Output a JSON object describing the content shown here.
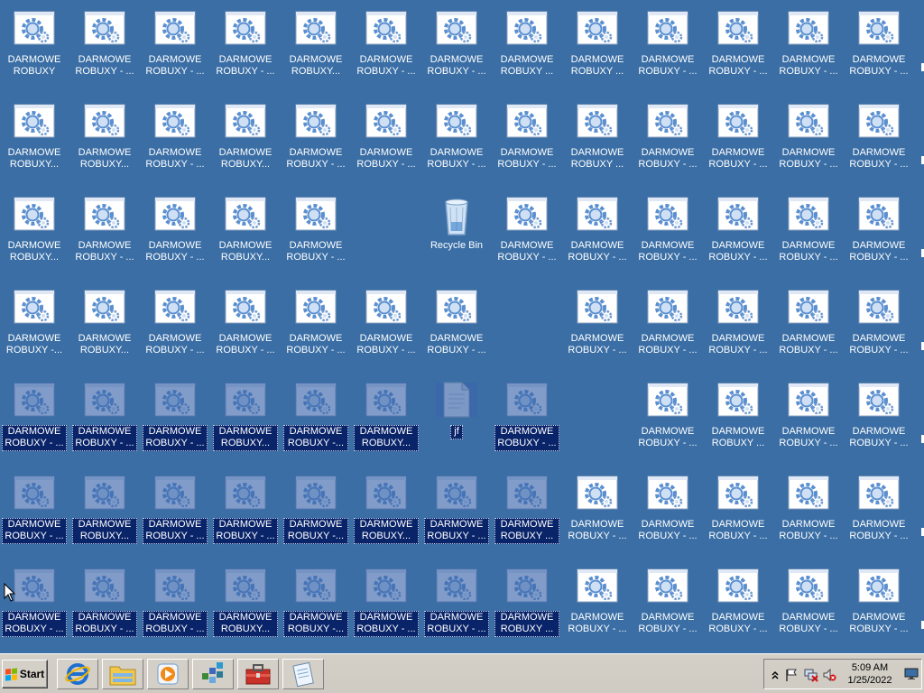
{
  "desktop": {
    "background_color": "#3a6ea5",
    "selection_color": "#0a246a",
    "icons": [
      {
        "label": "DARMOWE\nROBUXY",
        "type": "app",
        "selected": false,
        "col": 0,
        "row": 0
      },
      {
        "label": "DARMOWE\nROBUXY - ...",
        "type": "app",
        "selected": false,
        "col": 1,
        "row": 0
      },
      {
        "label": "DARMOWE\nROBUXY - ...",
        "type": "app",
        "selected": false,
        "col": 2,
        "row": 0
      },
      {
        "label": "DARMOWE\nROBUXY - ...",
        "type": "app",
        "selected": false,
        "col": 3,
        "row": 0
      },
      {
        "label": "DARMOWE\nROBUXY...",
        "type": "app",
        "selected": false,
        "col": 4,
        "row": 0
      },
      {
        "label": "DARMOWE\nROBUXY - ...",
        "type": "app",
        "selected": false,
        "col": 5,
        "row": 0
      },
      {
        "label": "DARMOWE\nROBUXY - ...",
        "type": "app",
        "selected": false,
        "col": 6,
        "row": 0
      },
      {
        "label": "DARMOWE\nROBUXY ...",
        "type": "app",
        "selected": false,
        "col": 7,
        "row": 0
      },
      {
        "label": "DARMOWE\nROBUXY ...",
        "type": "app",
        "selected": false,
        "col": 8,
        "row": 0
      },
      {
        "label": "DARMOWE\nROBUXY - ...",
        "type": "app",
        "selected": false,
        "col": 9,
        "row": 0
      },
      {
        "label": "DARMOWE\nROBUXY - ...",
        "type": "app",
        "selected": false,
        "col": 10,
        "row": 0
      },
      {
        "label": "DARMOWE\nROBUXY - ...",
        "type": "app",
        "selected": false,
        "col": 11,
        "row": 0
      },
      {
        "label": "DARMOWE\nROBUXY - ...",
        "type": "app",
        "selected": false,
        "col": 12,
        "row": 0
      },
      {
        "label": "DARMOWE\nROBUXY...",
        "type": "app",
        "selected": false,
        "col": 0,
        "row": 1
      },
      {
        "label": "DARMOWE\nROBUXY...",
        "type": "app",
        "selected": false,
        "col": 1,
        "row": 1
      },
      {
        "label": "DARMOWE\nROBUXY - ...",
        "type": "app",
        "selected": false,
        "col": 2,
        "row": 1
      },
      {
        "label": "DARMOWE\nROBUXY...",
        "type": "app",
        "selected": false,
        "col": 3,
        "row": 1
      },
      {
        "label": "DARMOWE\nROBUXY - ...",
        "type": "app",
        "selected": false,
        "col": 4,
        "row": 1
      },
      {
        "label": "DARMOWE\nROBUXY - ...",
        "type": "app",
        "selected": false,
        "col": 5,
        "row": 1
      },
      {
        "label": "DARMOWE\nROBUXY - ...",
        "type": "app",
        "selected": false,
        "col": 6,
        "row": 1
      },
      {
        "label": "DARMOWE\nROBUXY - ...",
        "type": "app",
        "selected": false,
        "col": 7,
        "row": 1
      },
      {
        "label": "DARMOWE\nROBUXY ...",
        "type": "app",
        "selected": false,
        "col": 8,
        "row": 1
      },
      {
        "label": "DARMOWE\nROBUXY - ...",
        "type": "app",
        "selected": false,
        "col": 9,
        "row": 1
      },
      {
        "label": "DARMOWE\nROBUXY - ...",
        "type": "app",
        "selected": false,
        "col": 10,
        "row": 1
      },
      {
        "label": "DARMOWE\nROBUXY - ...",
        "type": "app",
        "selected": false,
        "col": 11,
        "row": 1
      },
      {
        "label": "DARMOWE\nROBUXY - ...",
        "type": "app",
        "selected": false,
        "col": 12,
        "row": 1
      },
      {
        "label": "DARMOWE\nROBUXY...",
        "type": "app",
        "selected": false,
        "col": 0,
        "row": 2
      },
      {
        "label": "DARMOWE\nROBUXY - ...",
        "type": "app",
        "selected": false,
        "col": 1,
        "row": 2
      },
      {
        "label": "DARMOWE\nROBUXY - ...",
        "type": "app",
        "selected": false,
        "col": 2,
        "row": 2
      },
      {
        "label": "DARMOWE\nROBUXY...",
        "type": "app",
        "selected": false,
        "col": 3,
        "row": 2
      },
      {
        "label": "DARMOWE\nROBUXY - ...",
        "type": "app",
        "selected": false,
        "col": 4,
        "row": 2
      },
      {
        "label": "Recycle Bin",
        "type": "recycle",
        "selected": false,
        "col": 6,
        "row": 2
      },
      {
        "label": "DARMOWE\nROBUXY - ...",
        "type": "app",
        "selected": false,
        "col": 7,
        "row": 2
      },
      {
        "label": "DARMOWE\nROBUXY - ...",
        "type": "app",
        "selected": false,
        "col": 8,
        "row": 2
      },
      {
        "label": "DARMOWE\nROBUXY - ...",
        "type": "app",
        "selected": false,
        "col": 9,
        "row": 2
      },
      {
        "label": "DARMOWE\nROBUXY - ...",
        "type": "app",
        "selected": false,
        "col": 10,
        "row": 2
      },
      {
        "label": "DARMOWE\nROBUXY - ...",
        "type": "app",
        "selected": false,
        "col": 11,
        "row": 2
      },
      {
        "label": "DARMOWE\nROBUXY - ...",
        "type": "app",
        "selected": false,
        "col": 12,
        "row": 2
      },
      {
        "label": "DARMOWE\nROBUXY -...",
        "type": "app",
        "selected": false,
        "col": 0,
        "row": 3
      },
      {
        "label": "DARMOWE\nROBUXY...",
        "type": "app",
        "selected": false,
        "col": 1,
        "row": 3
      },
      {
        "label": "DARMOWE\nROBUXY - ...",
        "type": "app",
        "selected": false,
        "col": 2,
        "row": 3
      },
      {
        "label": "DARMOWE\nROBUXY - ...",
        "type": "app",
        "selected": false,
        "col": 3,
        "row": 3
      },
      {
        "label": "DARMOWE\nROBUXY - ...",
        "type": "app",
        "selected": false,
        "col": 4,
        "row": 3
      },
      {
        "label": "DARMOWE\nROBUXY - ...",
        "type": "app",
        "selected": false,
        "col": 5,
        "row": 3
      },
      {
        "label": "DARMOWE\nROBUXY - ...",
        "type": "app",
        "selected": false,
        "col": 6,
        "row": 3
      },
      {
        "label": "DARMOWE\nROBUXY - ...",
        "type": "app",
        "selected": false,
        "col": 8,
        "row": 3
      },
      {
        "label": "DARMOWE\nROBUXY - ...",
        "type": "app",
        "selected": false,
        "col": 9,
        "row": 3
      },
      {
        "label": "DARMOWE\nROBUXY - ...",
        "type": "app",
        "selected": false,
        "col": 10,
        "row": 3
      },
      {
        "label": "DARMOWE\nROBUXY - ...",
        "type": "app",
        "selected": false,
        "col": 11,
        "row": 3
      },
      {
        "label": "DARMOWE\nROBUXY - ...",
        "type": "app",
        "selected": false,
        "col": 12,
        "row": 3
      },
      {
        "label": "DARMOWE\nROBUXY - ...",
        "type": "app",
        "selected": true,
        "col": 0,
        "row": 4
      },
      {
        "label": "DARMOWE\nROBUXY - ...",
        "type": "app",
        "selected": true,
        "col": 1,
        "row": 4
      },
      {
        "label": "DARMOWE\nROBUXY - ...",
        "type": "app",
        "selected": true,
        "col": 2,
        "row": 4
      },
      {
        "label": "DARMOWE\nROBUXY...",
        "type": "app",
        "selected": true,
        "col": 3,
        "row": 4
      },
      {
        "label": "DARMOWE\nROBUXY -...",
        "type": "app",
        "selected": true,
        "col": 4,
        "row": 4
      },
      {
        "label": "DARMOWE\nROBUXY...",
        "type": "app",
        "selected": true,
        "col": 5,
        "row": 4
      },
      {
        "label": "jf",
        "type": "file",
        "selected": true,
        "col": 6,
        "row": 4
      },
      {
        "label": "DARMOWE\nROBUXY - ...",
        "type": "app",
        "selected": true,
        "col": 7,
        "row": 4
      },
      {
        "label": "DARMOWE\nROBUXY - ...",
        "type": "app",
        "selected": false,
        "col": 9,
        "row": 4
      },
      {
        "label": "DARMOWE\nROBUXY ...",
        "type": "app",
        "selected": false,
        "col": 10,
        "row": 4
      },
      {
        "label": "DARMOWE\nROBUXY - ...",
        "type": "app",
        "selected": false,
        "col": 11,
        "row": 4
      },
      {
        "label": "DARMOWE\nROBUXY - ...",
        "type": "app",
        "selected": false,
        "col": 12,
        "row": 4
      },
      {
        "label": "DARMOWE\nROBUXY - ...",
        "type": "app",
        "selected": true,
        "col": 0,
        "row": 5
      },
      {
        "label": "DARMOWE\nROBUXY...",
        "type": "app",
        "selected": true,
        "col": 1,
        "row": 5
      },
      {
        "label": "DARMOWE\nROBUXY - ...",
        "type": "app",
        "selected": true,
        "col": 2,
        "row": 5
      },
      {
        "label": "DARMOWE\nROBUXY - ...",
        "type": "app",
        "selected": true,
        "col": 3,
        "row": 5
      },
      {
        "label": "DARMOWE\nROBUXY -...",
        "type": "app",
        "selected": true,
        "col": 4,
        "row": 5
      },
      {
        "label": "DARMOWE\nROBUXY...",
        "type": "app",
        "selected": true,
        "col": 5,
        "row": 5
      },
      {
        "label": "DARMOWE\nROBUXY - ...",
        "type": "app",
        "selected": true,
        "col": 6,
        "row": 5
      },
      {
        "label": "DARMOWE\nROBUXY ...",
        "type": "app",
        "selected": true,
        "col": 7,
        "row": 5
      },
      {
        "label": "DARMOWE\nROBUXY - ...",
        "type": "app",
        "selected": false,
        "col": 8,
        "row": 5
      },
      {
        "label": "DARMOWE\nROBUXY - ...",
        "type": "app",
        "selected": false,
        "col": 9,
        "row": 5
      },
      {
        "label": "DARMOWE\nROBUXY - ...",
        "type": "app",
        "selected": false,
        "col": 10,
        "row": 5
      },
      {
        "label": "DARMOWE\nROBUXY - ...",
        "type": "app",
        "selected": false,
        "col": 11,
        "row": 5
      },
      {
        "label": "DARMOWE\nROBUXY - ...",
        "type": "app",
        "selected": false,
        "col": 12,
        "row": 5
      },
      {
        "label": "DARMOWE\nROBUXY - ...",
        "type": "app",
        "selected": true,
        "col": 0,
        "row": 6
      },
      {
        "label": "DARMOWE\nROBUXY - ...",
        "type": "app",
        "selected": true,
        "col": 1,
        "row": 6
      },
      {
        "label": "DARMOWE\nROBUXY - ...",
        "type": "app",
        "selected": true,
        "col": 2,
        "row": 6
      },
      {
        "label": "DARMOWE\nROBUXY...",
        "type": "app",
        "selected": true,
        "col": 3,
        "row": 6
      },
      {
        "label": "DARMOWE\nROBUXY -...",
        "type": "app",
        "selected": true,
        "col": 4,
        "row": 6
      },
      {
        "label": "DARMOWE\nROBUXY - ...",
        "type": "app",
        "selected": true,
        "col": 5,
        "row": 6
      },
      {
        "label": "DARMOWE\nROBUXY - ...",
        "type": "app",
        "selected": true,
        "col": 6,
        "row": 6
      },
      {
        "label": "DARMOWE\nROBUXY ...",
        "type": "app",
        "selected": true,
        "col": 7,
        "row": 6
      },
      {
        "label": "DARMOWE\nROBUXY - ...",
        "type": "app",
        "selected": false,
        "col": 8,
        "row": 6
      },
      {
        "label": "DARMOWE\nROBUXY - ...",
        "type": "app",
        "selected": false,
        "col": 9,
        "row": 6
      },
      {
        "label": "DARMOWE\nROBUXY - ...",
        "type": "app",
        "selected": false,
        "col": 10,
        "row": 6
      },
      {
        "label": "DARMOWE\nROBUXY - ...",
        "type": "app",
        "selected": false,
        "col": 11,
        "row": 6
      },
      {
        "label": "DARMOWE\nROBUXY - ...",
        "type": "app",
        "selected": false,
        "col": 12,
        "row": 6
      }
    ]
  },
  "taskbar": {
    "start_label": "Start",
    "quick_launch": [
      {
        "name": "internet-explorer-icon"
      },
      {
        "name": "windows-explorer-icon"
      },
      {
        "name": "media-player-icon"
      },
      {
        "name": "network-config-icon"
      },
      {
        "name": "toolbox-icon"
      },
      {
        "name": "notepad-icon"
      }
    ],
    "tray": {
      "icons": [
        "show-hidden-icons-chevron",
        "action-center-flag-icon",
        "network-disconnected-icon",
        "volume-muted-icon"
      ],
      "time": "5:09 AM",
      "date": "1/25/2022"
    }
  }
}
